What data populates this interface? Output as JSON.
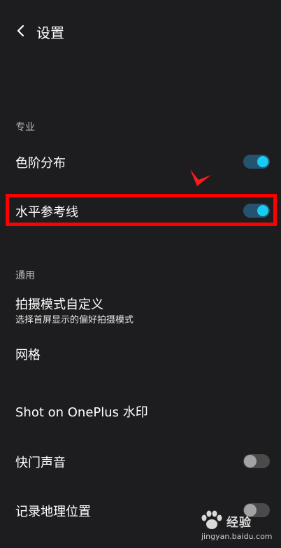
{
  "header": {
    "title": "设置"
  },
  "sections": {
    "pro_label": "专业",
    "general_label": "通用"
  },
  "rows": {
    "histogram": {
      "label": "色阶分布",
      "toggle": "on"
    },
    "horizon": {
      "label": "水平参考线",
      "toggle": "on"
    },
    "custom_mode": {
      "label": "拍摄模式自定义",
      "sub": "选择首屏显示的偏好拍摄模式"
    },
    "grid": {
      "label": "网格"
    },
    "watermark": {
      "label": "Shot on OnePlus 水印"
    },
    "shutter_sound": {
      "label": "快门声音",
      "toggle": "off"
    },
    "location": {
      "label": "记录地理位置",
      "toggle": "off"
    }
  },
  "watermark_overlay": {
    "brand": "经验",
    "url": "jingyan.baidu.com"
  },
  "colors": {
    "background": "#1d1d1f",
    "toggle_on_knob": "#18cbf2",
    "toggle_on_track": "#25526e",
    "toggle_off_knob": "#a3a3a3",
    "toggle_off_track": "#4a4a4a",
    "highlight": "#ff0000"
  },
  "icons": {
    "back": "chevron-left-icon",
    "annotation": "red-arrow-icon",
    "watermark_logo": "baidu-paw-icon"
  }
}
